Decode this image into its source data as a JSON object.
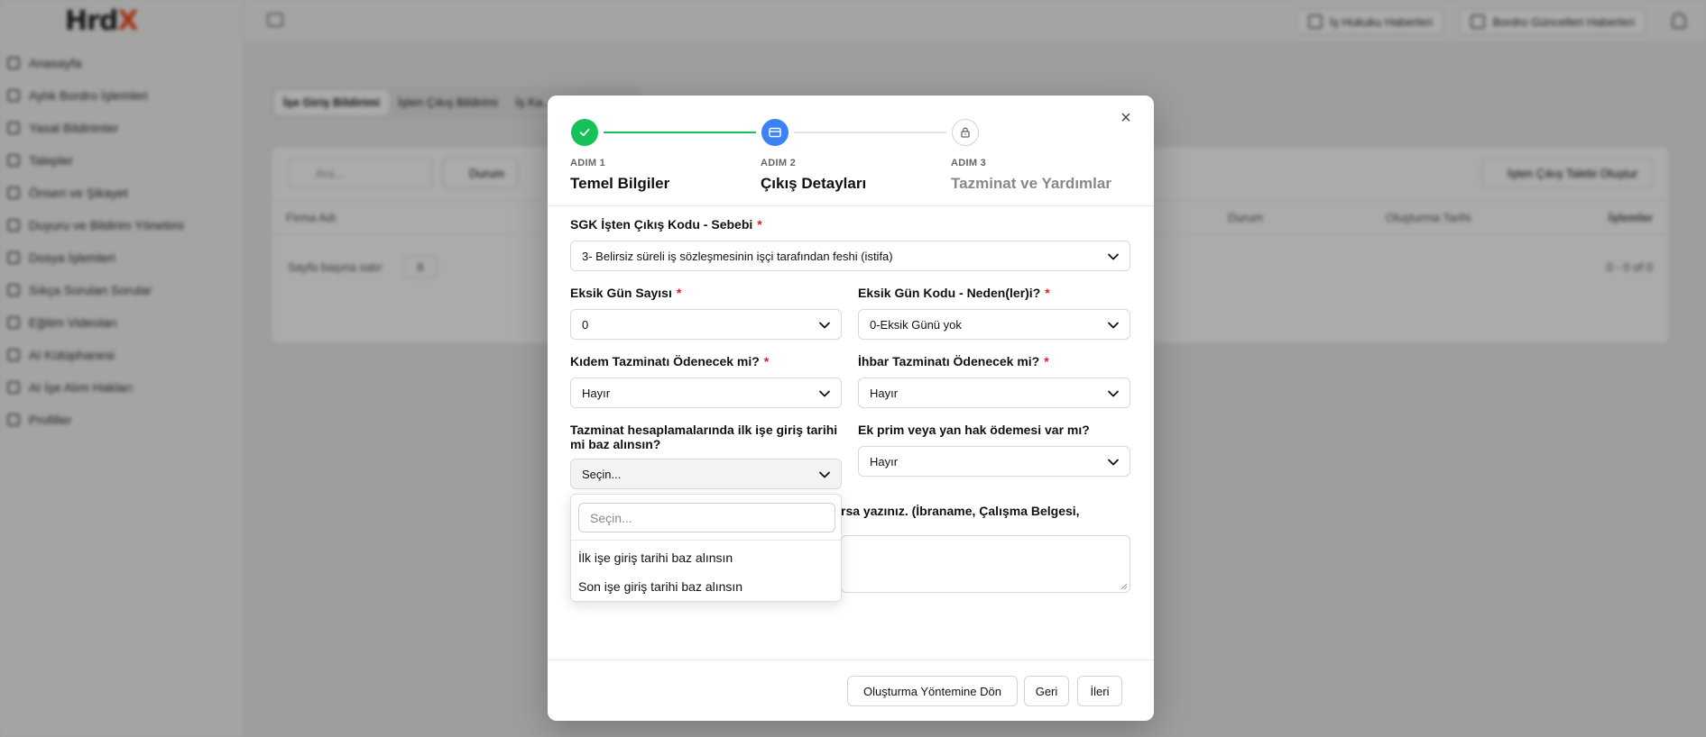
{
  "background": {
    "logo": {
      "main": "Hrd",
      "accent": "X"
    },
    "sidebar_items": [
      "Anasayfa",
      "Aylık Bordro İşlemleri",
      "Yasal Bildirimler",
      "Talepler",
      "Önseri ve Şikayet",
      "Duyuru ve Bildirim Yönetimi",
      "Dosya İşlemleri",
      "Sıkça Sorulan Sorular",
      "Eğitim Videoları",
      "AI Kütüphanesi",
      "AI İşe Alım Hakları",
      "Profiller"
    ],
    "top_buttons": [
      "İş Hukuku Haberleri",
      "Bordro Güncelleri Haberleri"
    ],
    "tabs": [
      "İşe Giriş Bildirimi",
      "İşten Çıkış Bildirimi",
      "İş Ka..."
    ],
    "search_placeholder": "Ara...",
    "filter_label": "Durum",
    "create_label": "İşten Çıkış Talebi Oluştur",
    "table_headers": [
      "Firma Adı",
      "Durum",
      "Oluşturma Tarihi",
      "İşlemler"
    ],
    "pager_label": "Sayfa başına satır",
    "pager_value": "8",
    "pager_range": "0 - 0 of 0"
  },
  "modal": {
    "close_icon": "×",
    "steps": [
      {
        "small": "ADIM 1",
        "title": "Temel Bilgiler",
        "state": "done",
        "icon": "check-icon"
      },
      {
        "small": "ADIM 2",
        "title": "Çıkış Detayları",
        "state": "active",
        "icon": "card-icon"
      },
      {
        "small": "ADIM 3",
        "title": "Tazminat ve Yardımlar",
        "state": "locked",
        "icon": "lock-icon"
      }
    ],
    "fields": {
      "sgk": {
        "label": "SGK İşten Çıkış Kodu - Sebebi",
        "value": "3- Belirsiz süreli iş sözleşmesinin işçi tarafından feshi (istifa)"
      },
      "eksik_gun_sayisi": {
        "label": "Eksik Gün Sayısı",
        "value": "0"
      },
      "eksik_gun_kodu": {
        "label": "Eksik Gün Kodu - Neden(ler)i?",
        "value": "0-Eksik Günü yok"
      },
      "kidem": {
        "label": "Kıdem Tazminatı Ödenecek mi?",
        "value": "Hayır"
      },
      "ihbar": {
        "label": "İhbar Tazminatı Ödenecek mi?",
        "value": "Hayır"
      },
      "baz": {
        "label": "Tazminat hesaplamalarında ilk işe giriş tarihi mi baz alınsın?",
        "value": "Seçin..."
      },
      "ek_prim": {
        "label": "Ek prim veya yan hak ödemesi var mı?",
        "value": "Hayır"
      },
      "notes_label_visible": "rsa yazınız. (İbraname, Çalışma Belgesi,"
    },
    "dropdown": {
      "search_placeholder": "Seçin...",
      "options": [
        "İlk işe giriş tarihi baz alınsın",
        "Son işe giriş tarihi baz alınsın"
      ]
    },
    "buttons": {
      "back_to_method": "Oluşturma Yöntemine Dön",
      "back": "Geri",
      "next": "İleri"
    },
    "colors": {
      "done": "#16c15a",
      "active": "#3b82f6",
      "required": "#e11d2a"
    }
  }
}
